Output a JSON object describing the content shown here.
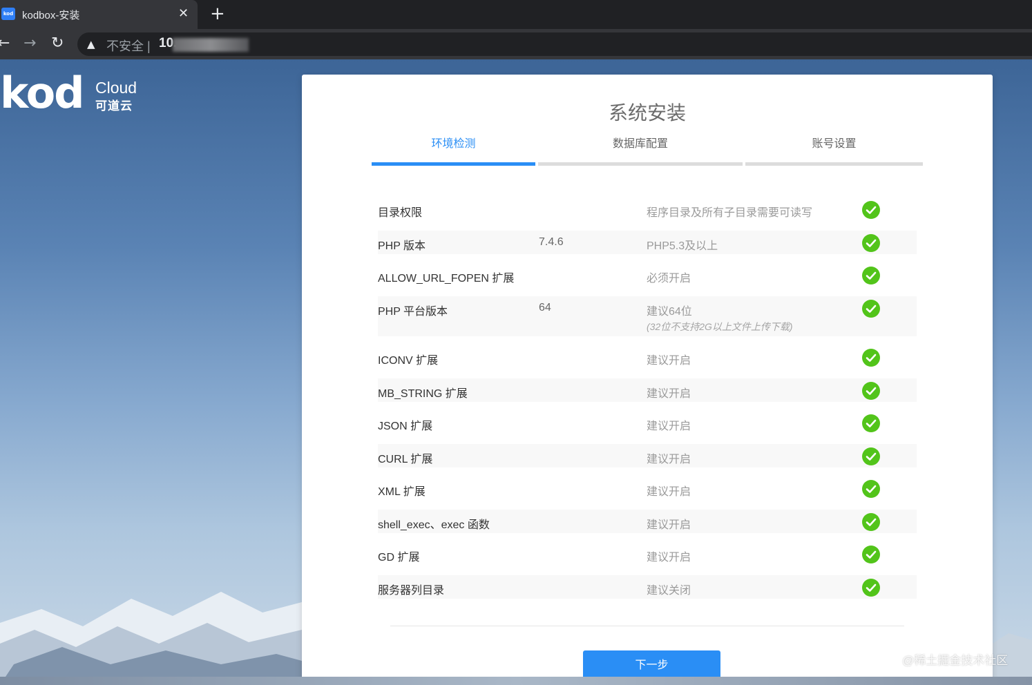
{
  "browser": {
    "tab_title": "kodbox-安装",
    "tab_favicon_text": "kod",
    "tab_close": "✕",
    "new_tab": "+",
    "back": "←",
    "forward": "→",
    "reload": "↻",
    "security_icon": "▲",
    "security_text": "不安全 |",
    "url": "10."
  },
  "logo": {
    "main": "kod",
    "cloud": "Cloud",
    "cn": "可道云"
  },
  "install": {
    "title": "系统安装",
    "steps": [
      {
        "label": "环境检测",
        "active": true
      },
      {
        "label": "数据库配置",
        "active": false
      },
      {
        "label": "账号设置",
        "active": false
      }
    ],
    "checks": [
      {
        "name": "目录权限",
        "value": "",
        "requirement": "程序目录及所有子目录需要可读写",
        "note": "",
        "status": "ok"
      },
      {
        "name": "PHP 版本",
        "value": "7.4.6",
        "requirement": "PHP5.3及以上",
        "note": "",
        "status": "ok"
      },
      {
        "name": "ALLOW_URL_FOPEN 扩展",
        "value": "",
        "requirement": "必须开启",
        "note": "",
        "status": "ok"
      },
      {
        "name": "PHP 平台版本",
        "value": "64",
        "requirement": "建议64位",
        "note": "(32位不支持2G以上文件上传下载)",
        "status": "ok"
      },
      {
        "name": "ICONV 扩展",
        "value": "",
        "requirement": "建议开启",
        "note": "",
        "status": "ok"
      },
      {
        "name": "MB_STRING 扩展",
        "value": "",
        "requirement": "建议开启",
        "note": "",
        "status": "ok"
      },
      {
        "name": "JSON 扩展",
        "value": "",
        "requirement": "建议开启",
        "note": "",
        "status": "ok"
      },
      {
        "name": "CURL 扩展",
        "value": "",
        "requirement": "建议开启",
        "note": "",
        "status": "ok"
      },
      {
        "name": "XML 扩展",
        "value": "",
        "requirement": "建议开启",
        "note": "",
        "status": "ok"
      },
      {
        "name": "shell_exec、exec 函数",
        "value": "",
        "requirement": "建议开启",
        "note": "",
        "status": "ok"
      },
      {
        "name": "GD 扩展",
        "value": "",
        "requirement": "建议开启",
        "note": "",
        "status": "ok"
      },
      {
        "name": "服务器列目录",
        "value": "",
        "requirement": "建议关闭",
        "note": "",
        "status": "ok"
      }
    ],
    "next_label": "下一步"
  },
  "watermark": "@稀土掘金技术社区",
  "colors": {
    "accent": "#2a8ef5",
    "ok_green": "#52c41a",
    "chrome_dark": "#202124",
    "chrome_tab": "#35363a"
  },
  "icons": {
    "status_ok": "check-circle-icon",
    "security": "warning-triangle-icon"
  }
}
